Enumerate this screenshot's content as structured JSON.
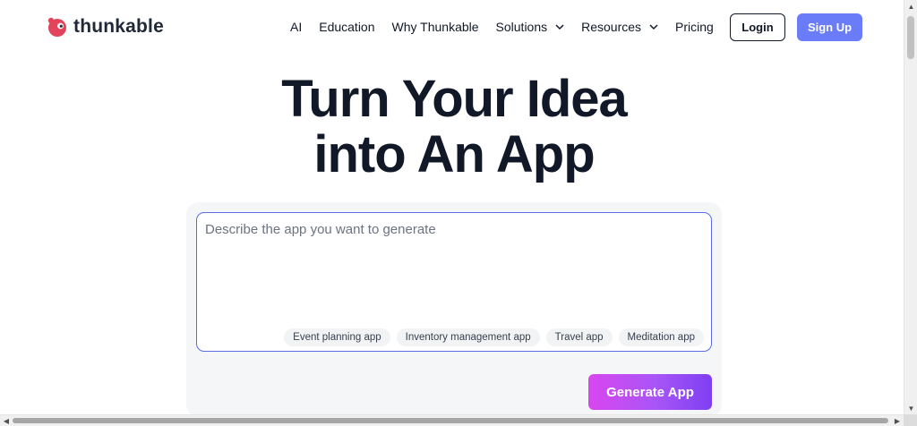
{
  "brand": {
    "name": "thunkable",
    "color": "#e2445c"
  },
  "nav": {
    "items": [
      {
        "label": "AI",
        "has_dropdown": false
      },
      {
        "label": "Education",
        "has_dropdown": false
      },
      {
        "label": "Why Thunkable",
        "has_dropdown": false
      },
      {
        "label": "Solutions",
        "has_dropdown": true
      },
      {
        "label": "Resources",
        "has_dropdown": true
      },
      {
        "label": "Pricing",
        "has_dropdown": false
      }
    ],
    "login_label": "Login",
    "signup_label": "Sign Up"
  },
  "hero": {
    "title_line1": "Turn Your Idea",
    "title_line2": "into An App"
  },
  "prompt": {
    "placeholder": "Describe the app you want to generate",
    "suggestions": [
      "Event planning app",
      "Inventory management app",
      "Travel app",
      "Meditation app"
    ],
    "generate_label": "Generate App"
  },
  "colors": {
    "accent": "#6b7cf8",
    "text": "#111827",
    "generate_gradient_start": "#d946ef",
    "generate_gradient_end": "#7e3ff2"
  },
  "icons": {
    "logo": "thunkable-logo-icon",
    "dropdown": "chevron-down-icon"
  }
}
